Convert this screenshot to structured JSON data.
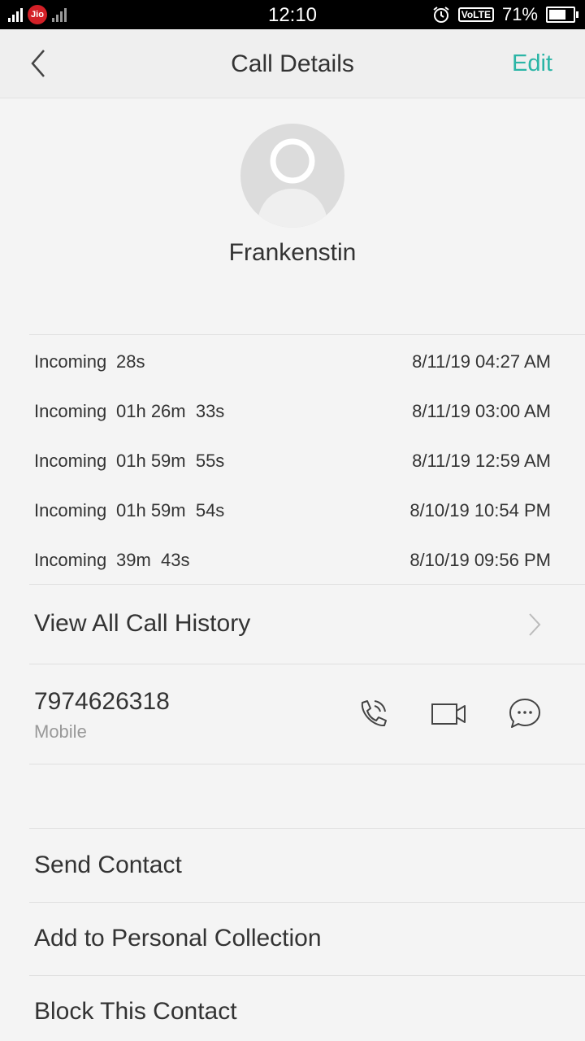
{
  "status_bar": {
    "time": "12:10",
    "carrier": "Jio",
    "volte": "VoLTE",
    "battery": "71%",
    "battery_level": 0.71,
    "icons": [
      "signal-icon",
      "jio-icon",
      "signal-secondary-icon",
      "alarm-icon",
      "volte-icon",
      "battery-icon"
    ]
  },
  "header": {
    "title": "Call Details",
    "edit_label": "Edit",
    "accent_color": "#2bb5a6"
  },
  "contact": {
    "name": "Frankenstin"
  },
  "call_log": [
    {
      "type": "Incoming",
      "duration": "28s",
      "timestamp": "8/11/19 04:27 AM"
    },
    {
      "type": "Incoming",
      "duration": "01h 26m  33s",
      "timestamp": "8/11/19 03:00 AM"
    },
    {
      "type": "Incoming",
      "duration": "01h 59m  55s",
      "timestamp": "8/11/19 12:59 AM"
    },
    {
      "type": "Incoming",
      "duration": "01h 59m  54s",
      "timestamp": "8/10/19 10:54 PM"
    },
    {
      "type": "Incoming",
      "duration": "39m  43s",
      "timestamp": "8/10/19 09:56 PM"
    }
  ],
  "view_all_label": "View All Call History",
  "phone": {
    "number": "7974626318",
    "label": "Mobile",
    "actions": [
      "phone-call-icon",
      "video-call-icon",
      "message-icon"
    ]
  },
  "menu": {
    "send_contact": "Send Contact",
    "add_to_collection": "Add to Personal Collection",
    "block_contact": "Block This Contact"
  }
}
